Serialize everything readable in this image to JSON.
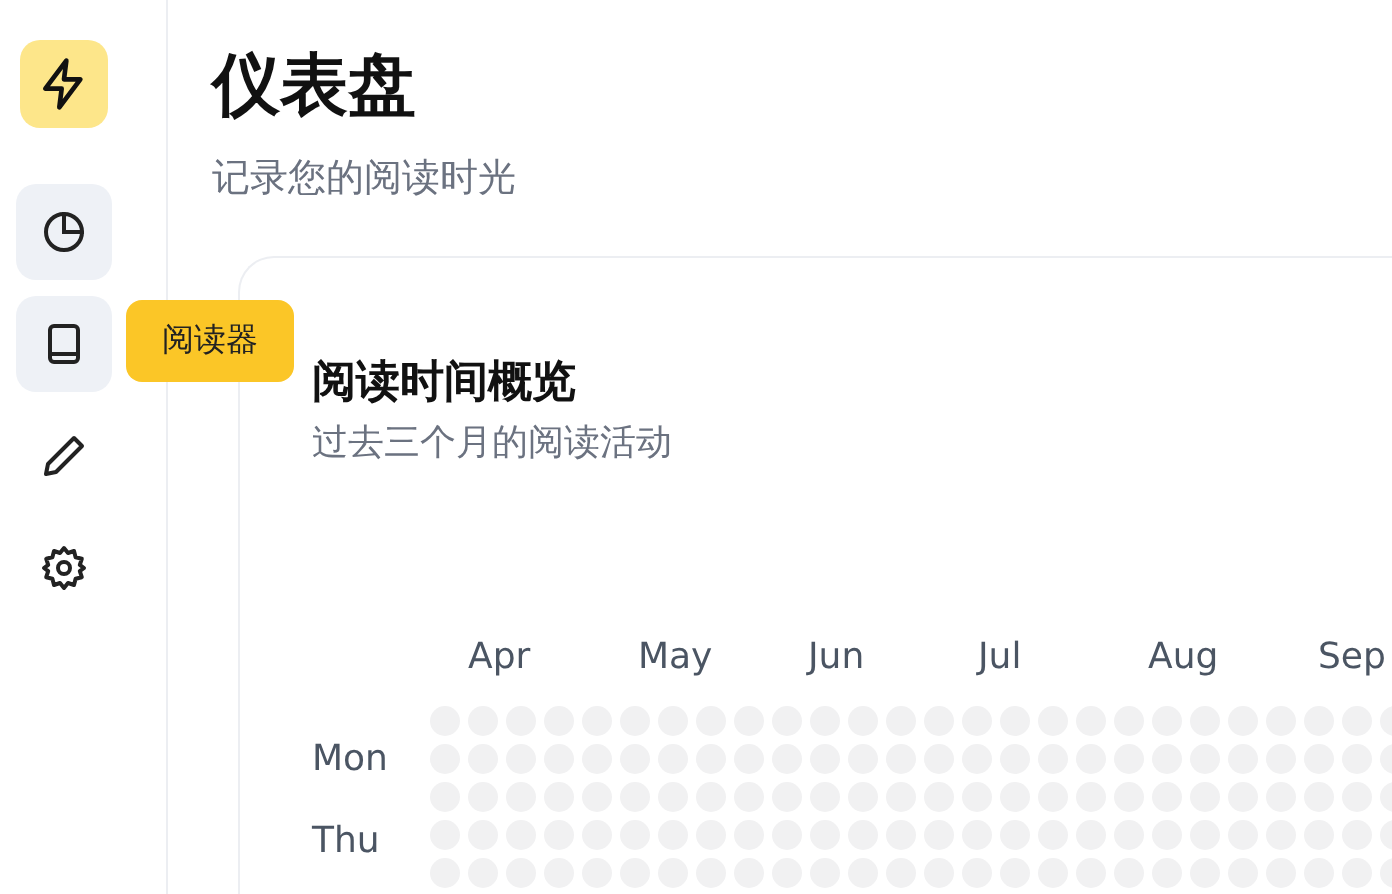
{
  "sidebar": {
    "items": [
      {
        "kind": "pie",
        "highlighted": true
      },
      {
        "kind": "book",
        "highlighted": true,
        "tooltip": "阅读器"
      },
      {
        "kind": "pencil",
        "highlighted": false
      },
      {
        "kind": "gear",
        "highlighted": false
      }
    ]
  },
  "header": {
    "title": "仪表盘",
    "subtitle": "记录您的阅读时光"
  },
  "card": {
    "title": "阅读时间概览",
    "subtitle": "过去三个月的阅读活动",
    "months": [
      "Apr",
      "May",
      "Jun",
      "Jul",
      "Aug",
      "Sep"
    ],
    "day_labels": [
      "Mon",
      "Thu"
    ]
  }
}
